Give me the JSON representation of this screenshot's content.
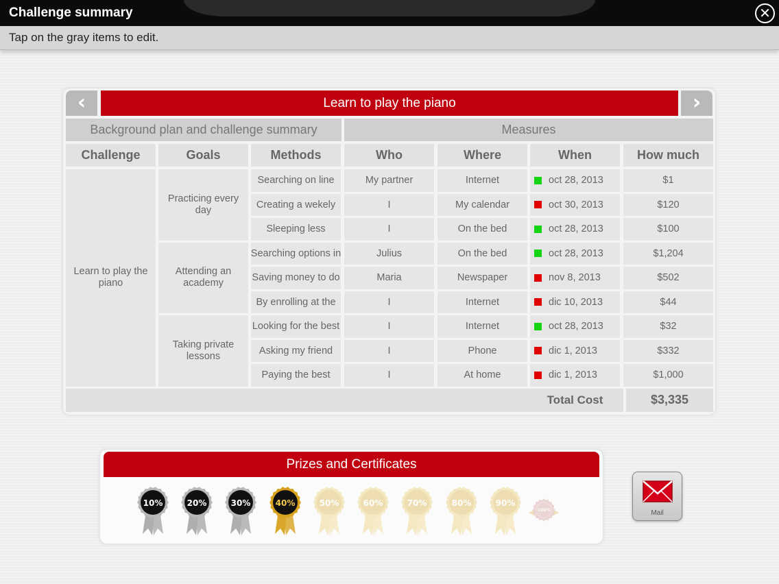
{
  "header": {
    "title": "Challenge summary",
    "close_icon": "close-icon"
  },
  "subbar": {
    "hint": "Tap on the gray items to edit."
  },
  "panel": {
    "prev_glyph": "‹",
    "next_glyph": "›",
    "challenge_title": "Learn to play the piano",
    "section_left": "Background plan and challenge summary",
    "section_right": "Measures",
    "columns": [
      "Challenge",
      "Goals",
      "Methods",
      "Who",
      "Where",
      "When",
      "How much"
    ],
    "challenge": "Learn to play the piano",
    "goals": [
      "Practicing every day",
      "Attending an academy",
      "Taking private lessons"
    ],
    "rows": [
      {
        "method": "Searching on line",
        "who": "My partner",
        "where": "Internet",
        "when": "oct 28, 2013",
        "status": "green",
        "much": "$1"
      },
      {
        "method": "Creating a wekely",
        "who": "I",
        "where": "My calendar",
        "when": "oct 30, 2013",
        "status": "red",
        "much": "$120"
      },
      {
        "method": "Sleeping less",
        "who": "I",
        "where": "On the bed",
        "when": "oct 28, 2013",
        "status": "green",
        "much": "$100"
      },
      {
        "method": "Searching options in",
        "who": "Julius",
        "where": "On the bed",
        "when": "oct 28, 2013",
        "status": "green",
        "much": "$1,204"
      },
      {
        "method": "Saving money to do",
        "who": "Maria",
        "where": "Newspaper",
        "when": "nov 8, 2013",
        "status": "red",
        "much": "$502"
      },
      {
        "method": "By enrolling at the",
        "who": "I",
        "where": "Internet",
        "when": "dic 10, 2013",
        "status": "red",
        "much": "$44"
      },
      {
        "method": "Looking for the best",
        "who": "I",
        "where": "Internet",
        "when": "oct 28, 2013",
        "status": "green",
        "much": "$32"
      },
      {
        "method": "Asking my friend",
        "who": "I",
        "where": "Phone",
        "when": "dic 1, 2013",
        "status": "red",
        "much": "$332"
      },
      {
        "method": "Paying the best",
        "who": "I",
        "where": "At home",
        "when": "dic 1, 2013",
        "status": "red",
        "much": "$1,000"
      }
    ],
    "total_label": "Total Cost",
    "total_value": "$3,335"
  },
  "status_colors": {
    "green": "#14d414",
    "red": "#e00000"
  },
  "prizes": {
    "title": "Prizes and Certificates",
    "medals": [
      {
        "label": "10%",
        "style": "silver"
      },
      {
        "label": "20%",
        "style": "silver"
      },
      {
        "label": "30%",
        "style": "silver"
      },
      {
        "label": "40%",
        "style": "gold"
      },
      {
        "label": "50%",
        "style": "faded"
      },
      {
        "label": "60%",
        "style": "faded"
      },
      {
        "label": "70%",
        "style": "faded"
      },
      {
        "label": "80%",
        "style": "faded"
      },
      {
        "label": "90%",
        "style": "faded"
      },
      {
        "label": "100%",
        "style": "seal"
      }
    ]
  },
  "mail": {
    "label": "Mail",
    "icon": "envelope-icon"
  }
}
